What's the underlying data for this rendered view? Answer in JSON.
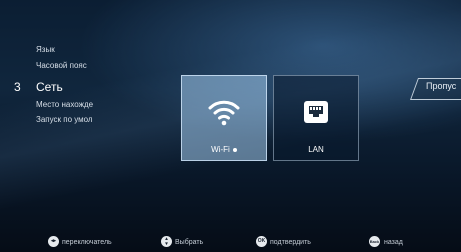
{
  "menu": {
    "language": "Язык",
    "timezone": "Часовой пояс",
    "step_number": "3",
    "network": "Сеть",
    "location": "Место нахожде",
    "default_launch": "Запуск по умол"
  },
  "tiles": {
    "wifi_label": "Wi-Fi",
    "lan_label": "LAN"
  },
  "skip_label": "Пропус",
  "footer": {
    "switch": "переключатель",
    "select": "Выбрать",
    "ok_icon": "OK",
    "confirm": "подтвердить",
    "back_icon": "Back",
    "back": "назад"
  },
  "icons": [
    "left-right-arrows-icon",
    "up-down-arrows-icon",
    "ok-icon",
    "back-icon",
    "wifi-icon",
    "ethernet-icon"
  ]
}
